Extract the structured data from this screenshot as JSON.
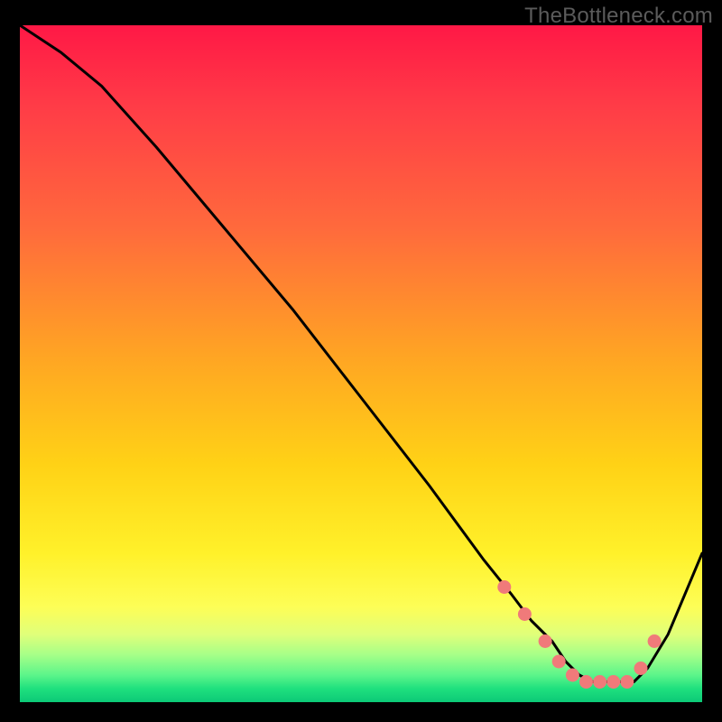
{
  "watermark": "TheBottleneck.com",
  "colors": {
    "background": "#000000",
    "line": "#000000",
    "marker": "#f07a7a"
  },
  "chart_data": {
    "type": "line",
    "title": "",
    "xlabel": "",
    "ylabel": "",
    "xlim": [
      0,
      100
    ],
    "ylim": [
      0,
      100
    ],
    "grid": false,
    "series": [
      {
        "name": "curve",
        "x": [
          0,
          6,
          12,
          20,
          30,
          40,
          50,
          60,
          68,
          72,
          75,
          78,
          80,
          82,
          84,
          86,
          88,
          90,
          92,
          95,
          100
        ],
        "y": [
          100,
          96,
          91,
          82,
          70,
          58,
          45,
          32,
          21,
          16,
          12,
          9,
          6,
          4,
          3,
          3,
          3,
          3,
          5,
          10,
          22
        ]
      }
    ],
    "markers": {
      "name": "highlight-points",
      "x": [
        71,
        74,
        77,
        79,
        81,
        83,
        85,
        87,
        89,
        91,
        93
      ],
      "y": [
        17,
        13,
        9,
        6,
        4,
        3,
        3,
        3,
        3,
        5,
        9
      ]
    },
    "gradient_stops": [
      {
        "pos": 0.0,
        "color": "#ff1846"
      },
      {
        "pos": 0.12,
        "color": "#ff3c47"
      },
      {
        "pos": 0.3,
        "color": "#ff6a3c"
      },
      {
        "pos": 0.5,
        "color": "#ffa822"
      },
      {
        "pos": 0.65,
        "color": "#ffd216"
      },
      {
        "pos": 0.78,
        "color": "#fff12a"
      },
      {
        "pos": 0.86,
        "color": "#fdfe57"
      },
      {
        "pos": 0.9,
        "color": "#e0ff7a"
      },
      {
        "pos": 0.93,
        "color": "#a6ff88"
      },
      {
        "pos": 0.96,
        "color": "#5cf58a"
      },
      {
        "pos": 0.98,
        "color": "#1fe07e"
      },
      {
        "pos": 1.0,
        "color": "#0cc977"
      }
    ]
  }
}
